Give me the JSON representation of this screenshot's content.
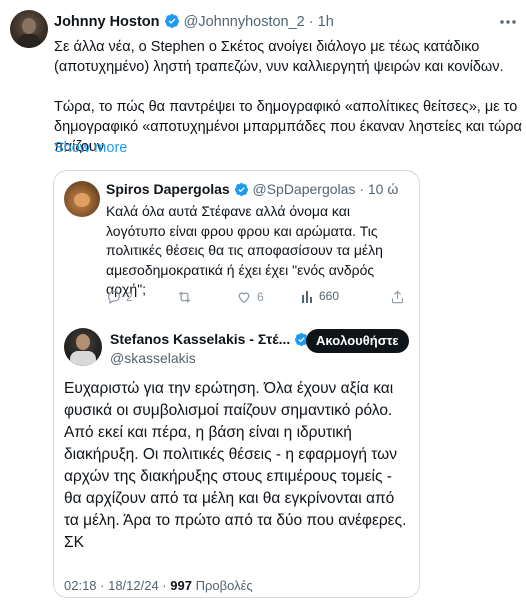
{
  "tweet": {
    "author_name": "Johnny Hoston",
    "handle": "@Johnnyhoston_2",
    "sep": "·",
    "time": "1h",
    "text_line1": "Σε άλλα νέα, ο Stephen ο Σκέτος ανοίγει διάλογο με τέως κατάδικο",
    "text_line2": "(αποτυχημένο) ληστή τραπεζών, νυν καλλιεργητή ψειρών και κονίδων.",
    "text_line3": "Τώρα, το πώς θα παντρέψει το δημογραφικό «απολίτικες θείτσες», με το",
    "text_line4": "δημογραφικό «αποτυχημένοι μπαρμπάδες που έκαναν ληστείες και τώρα το",
    "text_line5": "παίζουν",
    "show_more": "Show more"
  },
  "reply": {
    "author_name": "Spiros Dapergolas",
    "handle": "@SpDapergolas",
    "sep": "·",
    "time": "10 ώ",
    "line1": "Καλά όλα αυτά Στέφανε αλλά όνομα και",
    "line2": "λογότυπο είναι φρου φρου και αρώματα. Τις",
    "line3": "πολιτικές θέσεις θα τις αποφασίσουν τα μέλη",
    "line4": "αμεσοδημοκρατικά ή έχει έχει \"ενός ανδρός",
    "line5": "αρχή\";",
    "replies": "2",
    "likes": "6",
    "views": "660"
  },
  "quoted": {
    "author_name": "Stefanos Kasselakis - Στέ...",
    "handle": "@skasselakis",
    "follow_label": "Ακολουθήστε",
    "line1": "Ευχαριστώ για την ερώτηση. Όλα έχουν αξία και",
    "line2": "φυσικά οι συμβολισμοί παίζουν σημαντικό ρόλο.",
    "line3": "Από εκεί και πέρα, η βάση είναι η ιδρυτική",
    "line4": "διακήρυξη. Οι πολιτικές θέσεις - η εφαρμογή των",
    "line5": "αρχών της διακήρυξης στους επιμέρους τομείς -",
    "line6": "θα αρχίζουν από τα μέλη και θα εγκρίνονται από",
    "line7": "τα μέλη. Άρα το πρώτο από τα δύο που ανέφερες.",
    "line8": "ΣΚ",
    "timestamp": "02:18 · 18/12/24 ·",
    "view_count": "997",
    "view_label": "Προβολές"
  },
  "colors": {
    "verified": "#1d9bf0",
    "link": "#1d9bf0",
    "muted": "#536471"
  }
}
